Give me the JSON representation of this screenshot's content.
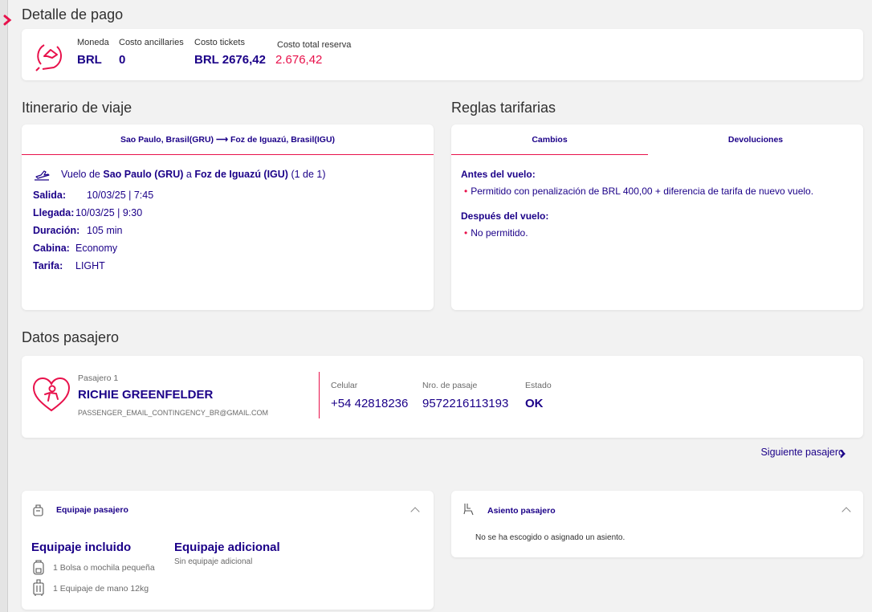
{
  "payment": {
    "title": "Detalle de pago",
    "currency_label": "Moneda",
    "currency_value": "BRL",
    "ancillary_label": "Costo ancillaries",
    "ancillary_value": "0",
    "tickets_label": "Costo tickets",
    "tickets_value": "BRL 2676,42",
    "total_label": "Costo total reserva",
    "total_value": "2.676,42"
  },
  "itinerary": {
    "title": "Itinerario de viaje",
    "route_header": "Sao Paulo, Brasil(GRU) ⟶ Foz de Iguazú, Brasil(IGU)",
    "flight_prefix": "Vuelo de",
    "origin": "Sao Paulo (GRU)",
    "flight_mid": "a",
    "destination": "Foz de Iguazú (IGU)",
    "segment_count": "(1 de 1)",
    "rows": [
      {
        "key": "Salida:",
        "value": "10/03/25 | 7:45"
      },
      {
        "key": "Llegada:",
        "value": "10/03/25 | 9:30"
      },
      {
        "key": "Duración:",
        "value": "105 min"
      },
      {
        "key": "Cabina:",
        "value": "Economy"
      },
      {
        "key": "Tarifa:",
        "value": "LIGHT"
      }
    ]
  },
  "fare_rules": {
    "title": "Reglas tarifarias",
    "tab_changes": "Cambios",
    "tab_refunds": "Devoluciones",
    "before_title": "Antes del vuelo:",
    "before_text": "Permitido con penalización de BRL 400,00 + diferencia de tarifa de nuevo vuelo.",
    "after_title": "Después del vuelo:",
    "after_text": "No permitido."
  },
  "passenger": {
    "title": "Datos pasajero",
    "label": "Pasajero 1",
    "name": "RICHIE GREENFELDER",
    "email": "PASSENGER_EMAIL_CONTINGENCY_BR@GMAIL.COM",
    "phone_label": "Celular",
    "phone_value": "+54 42818236",
    "ticket_label": "Nro. de pasaje",
    "ticket_value": "9572216113193",
    "status_label": "Estado",
    "status_value": "OK",
    "next_label": "Siguiente pasajero"
  },
  "baggage": {
    "title": "Equipaje pasajero",
    "included_title": "Equipaje incluido",
    "included_items": [
      "1 Bolsa o mochila pequeña",
      "1 Equipaje de mano 12kg"
    ],
    "additional_title": "Equipaje adicional",
    "additional_text": "Sin equipaje adicional"
  },
  "seat": {
    "title": "Asiento pasajero",
    "text": "No se ha escogido o asignado un asiento."
  },
  "colors": {
    "brand": "#1b0088",
    "accent": "#e8114b"
  },
  "icons": [
    "flight-handshake-icon",
    "plane-takeoff-icon",
    "passenger-heart-icon",
    "chevron-right-icon",
    "luggage-icon",
    "seat-icon",
    "chevron-up-icon",
    "arrow-right-icon"
  ]
}
